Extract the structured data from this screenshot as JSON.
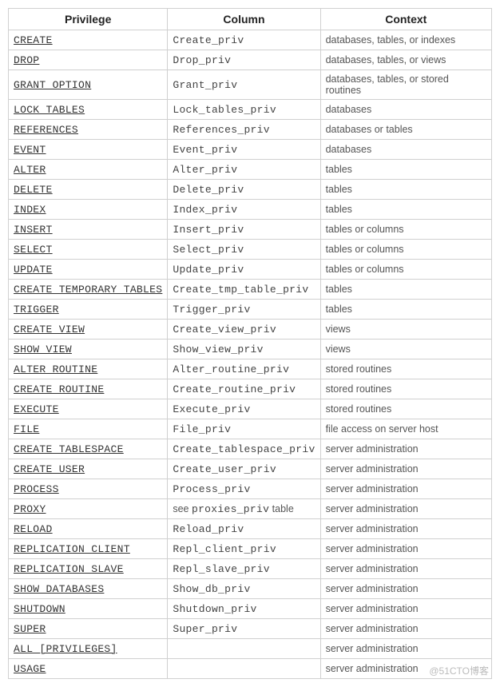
{
  "headers": {
    "privilege": "Privilege",
    "column": "Column",
    "context": "Context"
  },
  "rows": [
    {
      "privilege": "CREATE",
      "column": "Create_priv",
      "context": "databases, tables, or indexes"
    },
    {
      "privilege": "DROP",
      "column": "Drop_priv",
      "context": "databases, tables, or views"
    },
    {
      "privilege": "GRANT OPTION",
      "column": "Grant_priv",
      "context": "databases, tables, or stored routines"
    },
    {
      "privilege": "LOCK TABLES",
      "column": "Lock_tables_priv",
      "context": "databases"
    },
    {
      "privilege": "REFERENCES",
      "column": "References_priv",
      "context": "databases or tables"
    },
    {
      "privilege": "EVENT",
      "column": "Event_priv",
      "context": "databases"
    },
    {
      "privilege": "ALTER",
      "column": "Alter_priv",
      "context": "tables"
    },
    {
      "privilege": "DELETE",
      "column": "Delete_priv",
      "context": "tables"
    },
    {
      "privilege": "INDEX",
      "column": "Index_priv",
      "context": "tables"
    },
    {
      "privilege": "INSERT",
      "column": "Insert_priv",
      "context": "tables or columns"
    },
    {
      "privilege": "SELECT",
      "column": "Select_priv",
      "context": "tables or columns"
    },
    {
      "privilege": "UPDATE",
      "column": "Update_priv",
      "context": "tables or columns"
    },
    {
      "privilege": "CREATE TEMPORARY TABLES",
      "column": "Create_tmp_table_priv",
      "context": "tables"
    },
    {
      "privilege": "TRIGGER",
      "column": "Trigger_priv",
      "context": "tables"
    },
    {
      "privilege": "CREATE VIEW",
      "column": "Create_view_priv",
      "context": "views"
    },
    {
      "privilege": "SHOW VIEW",
      "column": "Show_view_priv",
      "context": "views"
    },
    {
      "privilege": "ALTER ROUTINE",
      "column": "Alter_routine_priv",
      "context": "stored routines"
    },
    {
      "privilege": "CREATE ROUTINE",
      "column": "Create_routine_priv",
      "context": "stored routines"
    },
    {
      "privilege": "EXECUTE",
      "column": "Execute_priv",
      "context": "stored routines"
    },
    {
      "privilege": "FILE",
      "column": "File_priv",
      "context": "file access on server host"
    },
    {
      "privilege": "CREATE TABLESPACE",
      "column": "Create_tablespace_priv",
      "context": "server administration"
    },
    {
      "privilege": "CREATE USER",
      "column": "Create_user_priv",
      "context": "server administration"
    },
    {
      "privilege": "PROCESS",
      "column": "Process_priv",
      "context": "server administration"
    },
    {
      "privilege": "PROXY",
      "column_prefix": "see ",
      "column_code": "proxies_priv",
      "column_suffix": " table",
      "context": "server administration"
    },
    {
      "privilege": "RELOAD",
      "column": "Reload_priv",
      "context": "server administration"
    },
    {
      "privilege": "REPLICATION CLIENT",
      "column": "Repl_client_priv",
      "context": "server administration"
    },
    {
      "privilege": "REPLICATION SLAVE",
      "column": "Repl_slave_priv",
      "context": "server administration"
    },
    {
      "privilege": "SHOW DATABASES",
      "column": "Show_db_priv",
      "context": "server administration"
    },
    {
      "privilege": "SHUTDOWN",
      "column": "Shutdown_priv",
      "context": "server administration"
    },
    {
      "privilege": "SUPER",
      "column": "Super_priv",
      "context": "server administration"
    },
    {
      "privilege": "ALL [PRIVILEGES]",
      "column": "",
      "context": "server administration"
    },
    {
      "privilege": "USAGE",
      "column": "",
      "context": "server administration"
    }
  ],
  "watermark": "@51CTO博客"
}
